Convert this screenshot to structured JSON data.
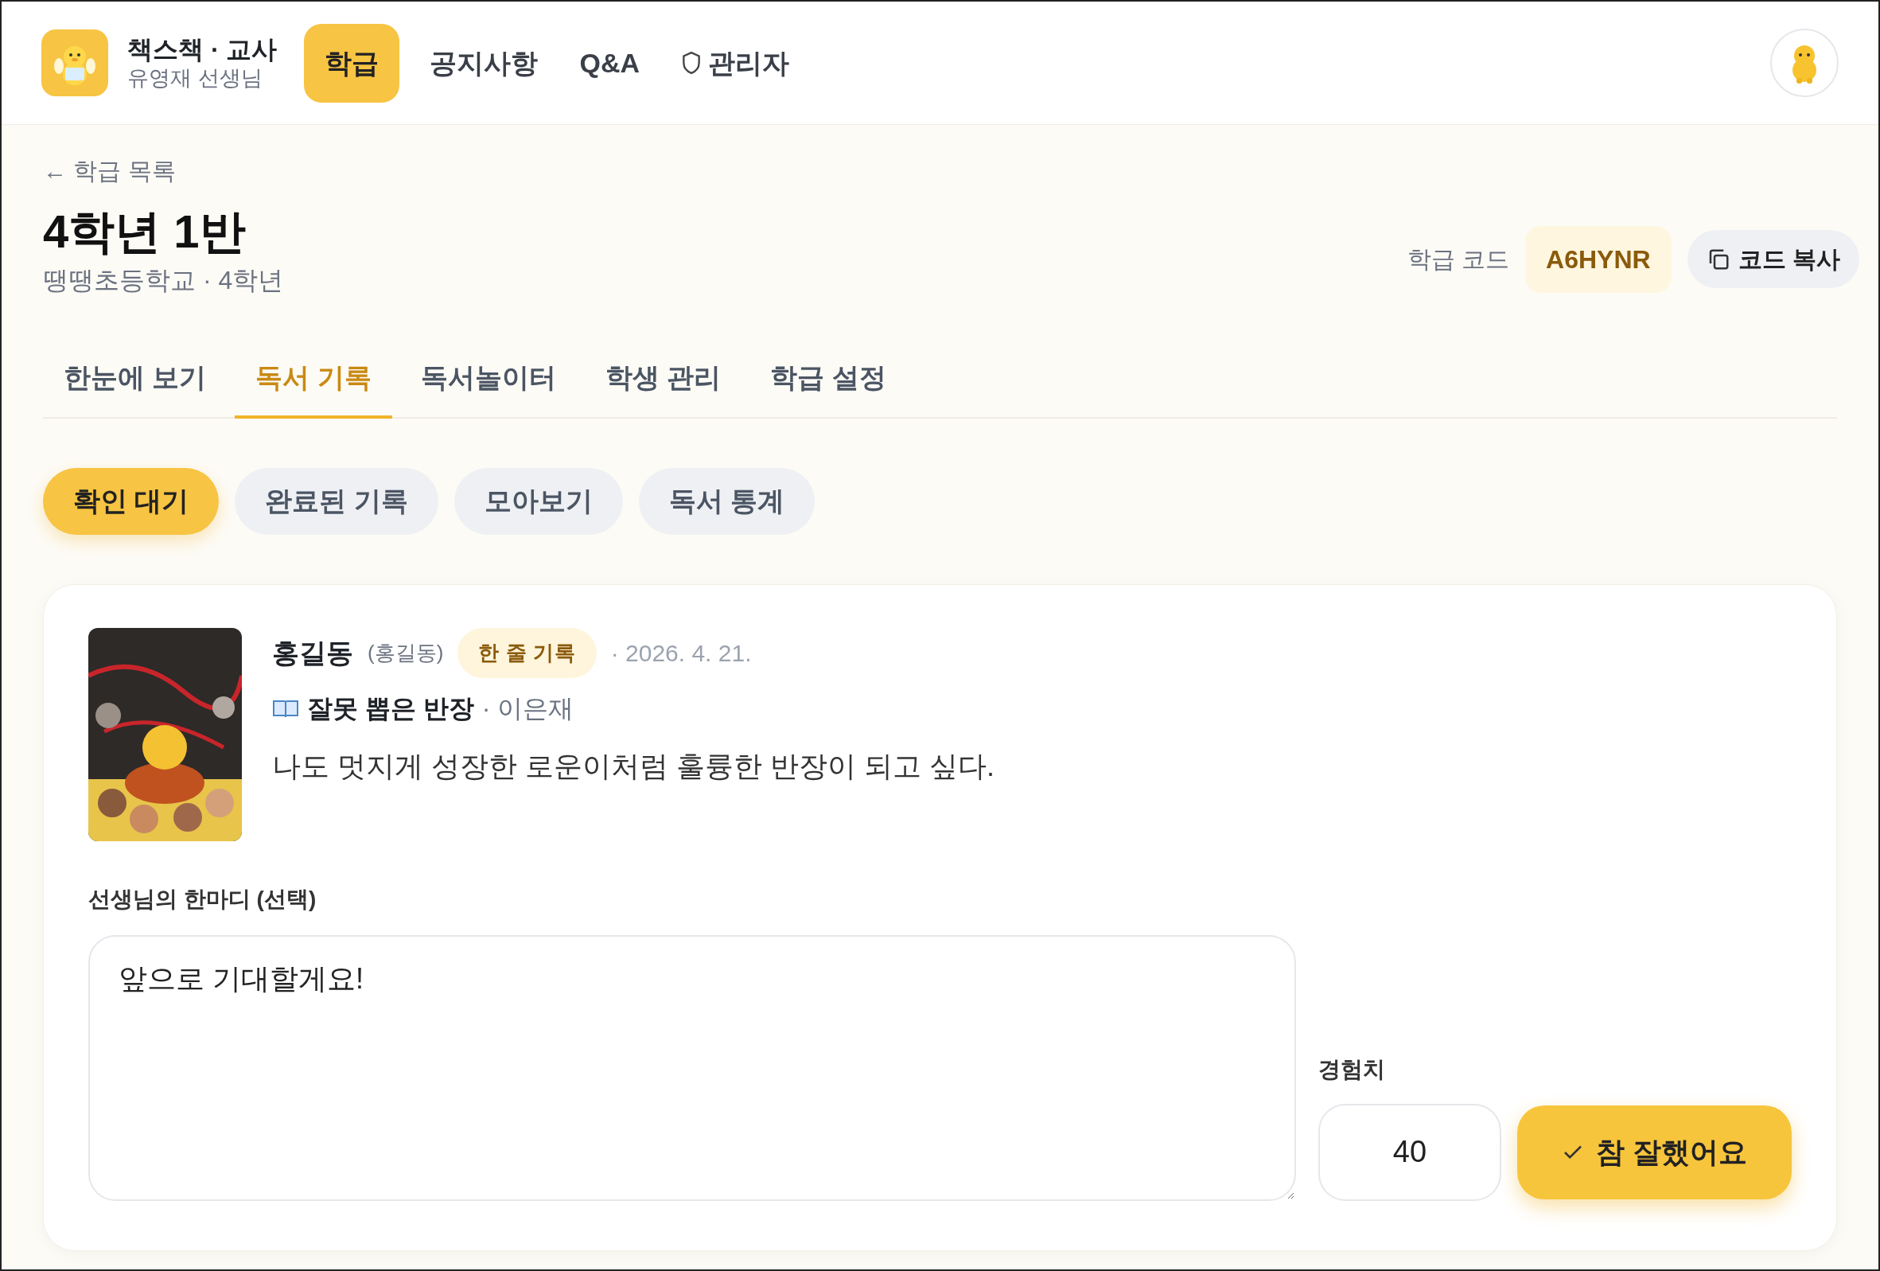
{
  "header": {
    "app_title": "책스책 · 교사",
    "user_name": "유영재 선생님",
    "nav": [
      {
        "label": "학급",
        "selected": true,
        "kind": "text"
      },
      {
        "label": "공지사항",
        "selected": false,
        "kind": "text"
      },
      {
        "label": "Q&A",
        "selected": false,
        "kind": "text"
      },
      {
        "label": "관리자",
        "selected": false,
        "kind": "shield"
      }
    ]
  },
  "class_header": {
    "back_link": "← 학급 목록",
    "title": "4학년 1반",
    "subtitle": "땡땡초등학교 · 4학년",
    "code_label": "학급 코드",
    "code": "A6HYNR",
    "copy_button": "코드 복사"
  },
  "tabs": [
    {
      "label": "한눈에 보기",
      "selected": false
    },
    {
      "label": "독서 기록",
      "selected": true
    },
    {
      "label": "독서놀이터",
      "selected": false
    },
    {
      "label": "학생 관리",
      "selected": false
    },
    {
      "label": "학급 설정",
      "selected": false
    }
  ],
  "filters": [
    {
      "label": "확인 대기",
      "selected": true
    },
    {
      "label": "완료된 기록",
      "selected": false
    },
    {
      "label": "모아보기",
      "selected": false
    },
    {
      "label": "독서 통계",
      "selected": false
    }
  ],
  "record": {
    "student_name": "홍길동",
    "student_nickname": "(홍길동)",
    "type_badge": "한 줄 기록",
    "date": "· 2026. 4. 21.",
    "book_title": "잘못 뽑은 반장",
    "book_author": "· 이은재",
    "text": "나도 멋지게 성장한 로운이처럼 훌륭한 반장이 되고 싶다.",
    "comment_label": "선생님의 한마디 (선택)",
    "comment": "앞으로 기대할게요!",
    "xp_label": "경험치",
    "xp": "40",
    "approve_button": "참 잘했어요"
  }
}
